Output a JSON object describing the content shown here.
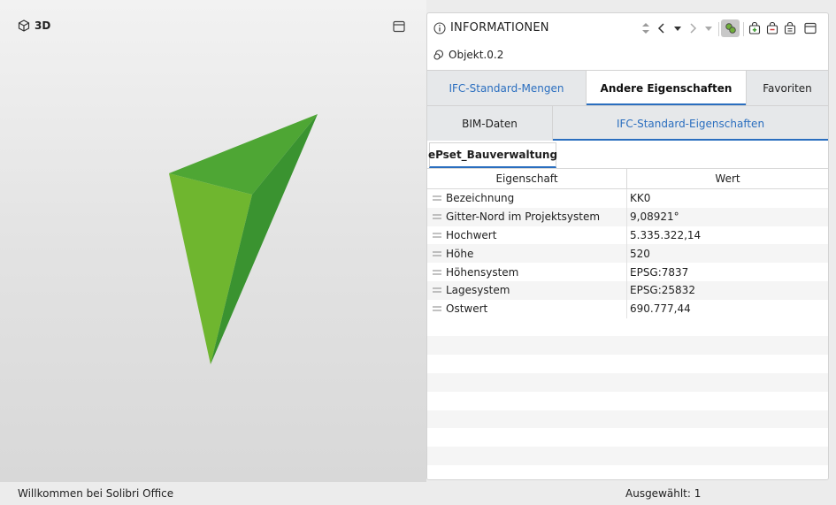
{
  "viewport": {
    "title": "3D",
    "icons": {
      "title": "cube-icon",
      "maximize": "window-icon"
    },
    "model_colors": {
      "light": "#6fb62f",
      "mid": "#4ea634",
      "dark": "#3a9330"
    }
  },
  "panel": {
    "title": "INFORMATIONEN",
    "icons": {
      "title": "info-icon",
      "toolbar": [
        "sort-arrows-icon",
        "back-icon",
        "dropdown-icon",
        "forward-icon",
        "dropdown-icon",
        "link-objects-icon",
        "add-bag-icon",
        "remove-bag-icon",
        "bag-icon",
        "window-icon"
      ]
    },
    "object_name": "Objekt.0.2",
    "tabs_row1": [
      {
        "label": "IFC-Standard-Mengen"
      },
      {
        "label": "Andere Eigenschaften",
        "selected": true
      },
      {
        "label": "Favoriten"
      }
    ],
    "tabs_row2": [
      {
        "label": "BIM-Daten"
      },
      {
        "label": "IFC-Standard-Eigenschaften"
      }
    ],
    "pset_tab": "ePset_Bauverwaltung",
    "table": {
      "headers": [
        "Eigenschaft",
        "Wert"
      ],
      "rows": [
        {
          "property": "Bezeichnung",
          "value": "KK0"
        },
        {
          "property": "Gitter-Nord im Projektsystem",
          "value": "9,08921°"
        },
        {
          "property": "Hochwert",
          "value": "5.335.322,14"
        },
        {
          "property": "Höhe",
          "value": "520"
        },
        {
          "property": "Höhensystem",
          "value": "EPSG:7837"
        },
        {
          "property": "Lagesystem",
          "value": "EPSG:25832"
        },
        {
          "property": "Ostwert",
          "value": "690.777,44"
        }
      ]
    },
    "accent_color": "#2a6ebf"
  },
  "status": {
    "left": "Willkommen bei Solibri Office",
    "right": "Ausgewählt: 1"
  }
}
